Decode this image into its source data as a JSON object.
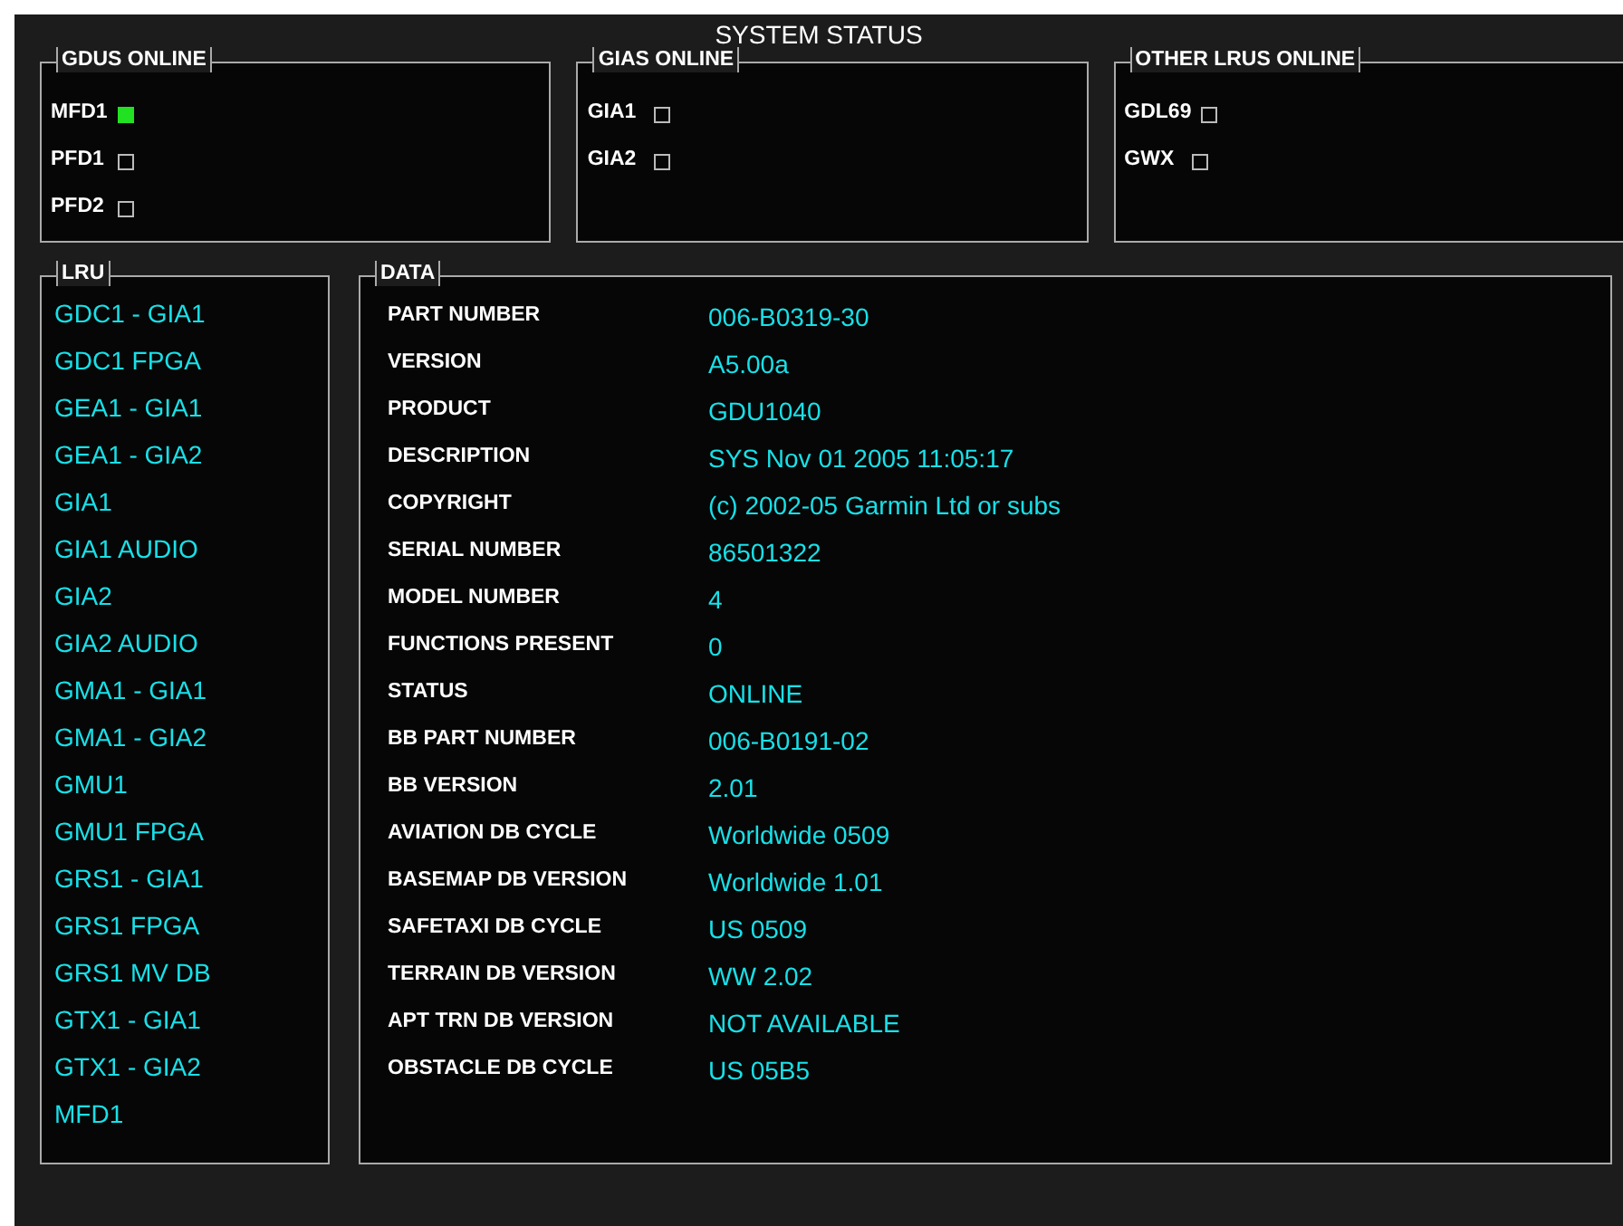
{
  "title": "SYSTEM STATUS",
  "status_groups": [
    {
      "title": "GDUS ONLINE",
      "items": [
        {
          "label": "MFD1",
          "online": true
        },
        {
          "label": "PFD1",
          "online": false
        },
        {
          "label": "PFD2",
          "online": false
        }
      ]
    },
    {
      "title": "GIAS ONLINE",
      "items": [
        {
          "label": "GIA1",
          "online": false
        },
        {
          "label": "GIA2",
          "online": false
        }
      ]
    },
    {
      "title": "OTHER LRUS ONLINE",
      "items": [
        {
          "label": "GDL69",
          "online": false
        },
        {
          "label": "GWX",
          "online": false
        }
      ]
    }
  ],
  "lru": {
    "title": "LRU",
    "items": [
      "GDC1 - GIA1",
      "GDC1 FPGA",
      "GEA1 - GIA1",
      "GEA1 - GIA2",
      "GIA1",
      "GIA1 AUDIO",
      "GIA2",
      "GIA2 AUDIO",
      "GMA1 - GIA1",
      "GMA1 - GIA2",
      "GMU1",
      "GMU1 FPGA",
      "GRS1 - GIA1",
      "GRS1 FPGA",
      "GRS1 MV DB",
      "GTX1 - GIA1",
      "GTX1 - GIA2",
      "MFD1"
    ]
  },
  "data": {
    "title": "DATA",
    "rows": [
      {
        "label": "PART NUMBER",
        "value": "006-B0319-30"
      },
      {
        "label": "VERSION",
        "value": "A5.00a"
      },
      {
        "label": "PRODUCT",
        "value": "GDU1040"
      },
      {
        "label": "DESCRIPTION",
        "value": "SYS Nov 01 2005 11:05:17"
      },
      {
        "label": "COPYRIGHT",
        "value": "(c) 2002-05 Garmin Ltd or subs"
      },
      {
        "label": "SERIAL NUMBER",
        "value": "86501322"
      },
      {
        "label": "MODEL NUMBER",
        "value": "4"
      },
      {
        "label": "FUNCTIONS PRESENT",
        "value": "0"
      },
      {
        "label": "STATUS",
        "value": "ONLINE"
      },
      {
        "label": "BB PART NUMBER",
        "value": "006-B0191-02"
      },
      {
        "label": "BB VERSION",
        "value": "2.01"
      },
      {
        "label": "AVIATION DB CYCLE",
        "value": "Worldwide 0509"
      },
      {
        "label": "BASEMAP DB VERSION",
        "value": "Worldwide 1.01"
      },
      {
        "label": "SAFETAXI DB CYCLE",
        "value": "US 0509"
      },
      {
        "label": "TERRAIN DB VERSION",
        "value": "WW 2.02"
      },
      {
        "label": "APT TRN DB VERSION",
        "value": "NOT AVAILABLE"
      },
      {
        "label": "OBSTACLE DB CYCLE",
        "value": "US 05B5"
      }
    ]
  }
}
